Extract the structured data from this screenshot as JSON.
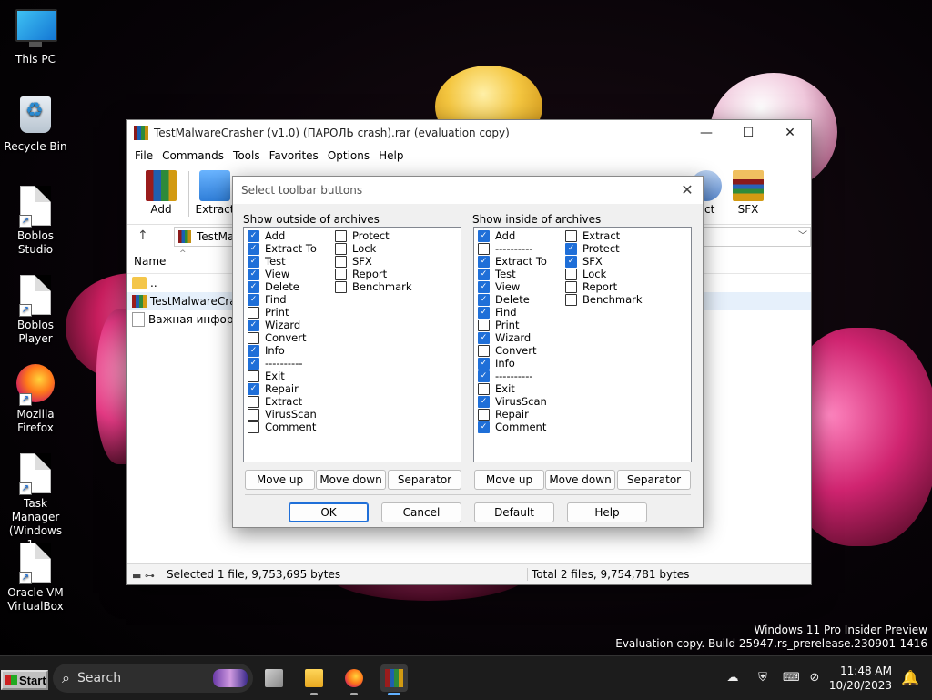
{
  "desktop": {
    "icons": [
      {
        "label": "This PC"
      },
      {
        "label": "Recycle Bin"
      },
      {
        "label": "Boblos Studio"
      },
      {
        "label": "Boblos Player"
      },
      {
        "label": "Mozilla Firefox"
      },
      {
        "label": "Task Manager (Windows 1..."
      },
      {
        "label": "Oracle VM VirtualBox"
      }
    ],
    "watermark": {
      "line1": "Windows 11 Pro Insider Preview",
      "line2": "Evaluation copy. Build 25947.rs_prerelease.230901-1416"
    }
  },
  "winrar": {
    "title": "TestMalwareCrasher (v1.0) (ПАРОЛЬ crash).rar (evaluation copy)",
    "menu": [
      "File",
      "Commands",
      "Tools",
      "Favorites",
      "Options",
      "Help"
    ],
    "toolbar": {
      "add": "Add",
      "extract": "Extract",
      "protect_partial": "ect",
      "sfx": "SFX"
    },
    "address": "TestMa",
    "column_name": "Name",
    "files": [
      {
        "name": ".."
      },
      {
        "name": "TestMalwareCra..."
      },
      {
        "name": "Важная инфор..."
      }
    ],
    "status_left": "Selected 1 file, 9,753,695 bytes",
    "status_right": "Total 2 files, 9,754,781 bytes"
  },
  "dialog": {
    "title": "Select toolbar buttons",
    "outside": {
      "label": "Show outside of archives",
      "col1": [
        {
          "label": "Add",
          "checked": true
        },
        {
          "label": "Extract To",
          "checked": true
        },
        {
          "label": "Test",
          "checked": true
        },
        {
          "label": "View",
          "checked": true
        },
        {
          "label": "Delete",
          "checked": true
        },
        {
          "label": "Find",
          "checked": true
        },
        {
          "label": "Print",
          "checked": false
        },
        {
          "label": "Wizard",
          "checked": true
        },
        {
          "label": "Convert",
          "checked": false
        },
        {
          "label": "Info",
          "checked": true
        },
        {
          "label": "----------",
          "checked": true
        },
        {
          "label": "Exit",
          "checked": false
        },
        {
          "label": "Repair",
          "checked": true
        },
        {
          "label": "Extract",
          "checked": false
        },
        {
          "label": "VirusScan",
          "checked": false
        },
        {
          "label": "Comment",
          "checked": false
        }
      ],
      "col2": [
        {
          "label": "Protect",
          "checked": false
        },
        {
          "label": "Lock",
          "checked": false
        },
        {
          "label": "SFX",
          "checked": false
        },
        {
          "label": "Report",
          "checked": false
        },
        {
          "label": "Benchmark",
          "checked": false
        }
      ]
    },
    "inside": {
      "label": "Show inside of archives",
      "col1": [
        {
          "label": "Add",
          "checked": true
        },
        {
          "label": "----------",
          "checked": false
        },
        {
          "label": "Extract To",
          "checked": true
        },
        {
          "label": "Test",
          "checked": true
        },
        {
          "label": "View",
          "checked": true
        },
        {
          "label": "Delete",
          "checked": true
        },
        {
          "label": "Find",
          "checked": true
        },
        {
          "label": "Print",
          "checked": false
        },
        {
          "label": "Wizard",
          "checked": true
        },
        {
          "label": "Convert",
          "checked": false
        },
        {
          "label": "Info",
          "checked": true
        },
        {
          "label": "----------",
          "checked": true
        },
        {
          "label": "Exit",
          "checked": false
        },
        {
          "label": "VirusScan",
          "checked": true
        },
        {
          "label": "Repair",
          "checked": false
        },
        {
          "label": "Comment",
          "checked": true
        }
      ],
      "col2": [
        {
          "label": "Extract",
          "checked": false
        },
        {
          "label": "Protect",
          "checked": true
        },
        {
          "label": "SFX",
          "checked": true
        },
        {
          "label": "Lock",
          "checked": false
        },
        {
          "label": "Report",
          "checked": false
        },
        {
          "label": "Benchmark",
          "checked": false
        }
      ]
    },
    "buttons": {
      "move_up": "Move up",
      "move_down": "Move down",
      "separator": "Separator",
      "ok": "OK",
      "cancel": "Cancel",
      "default": "Default",
      "help": "Help"
    }
  },
  "taskbar": {
    "start": "Start",
    "search_placeholder": "Search",
    "time": "11:48 AM",
    "date": "10/20/2023"
  },
  "colors": {
    "accent": "#1f6fd8",
    "taskbar": "#1c1c1c"
  }
}
